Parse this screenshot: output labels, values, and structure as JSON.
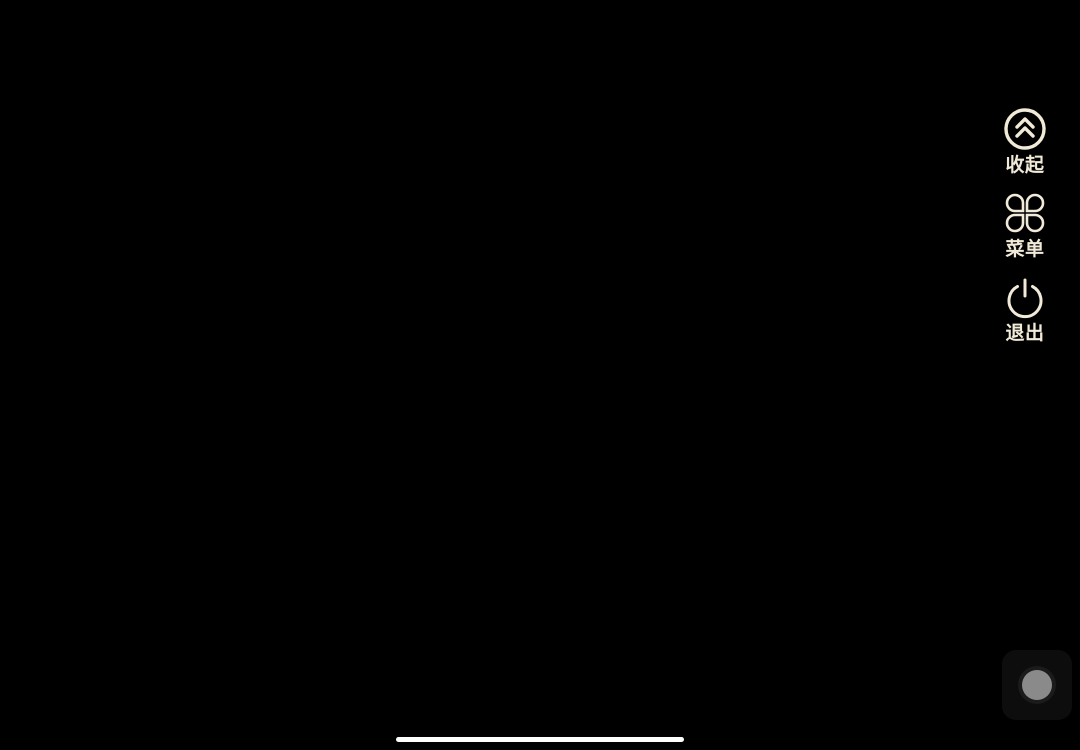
{
  "side_menu": {
    "items": [
      {
        "label": "收起",
        "icon": "chevron-double-up-icon"
      },
      {
        "label": "菜单",
        "icon": "menu-grid-icon"
      },
      {
        "label": "退出",
        "icon": "power-icon"
      }
    ]
  },
  "floating_button": {
    "icon": "assistive-touch-icon"
  },
  "colors": {
    "background": "#000000",
    "menu_accent": "#f2ead8",
    "float_ball": "#8a8a8a",
    "home_indicator": "#ffffff"
  }
}
